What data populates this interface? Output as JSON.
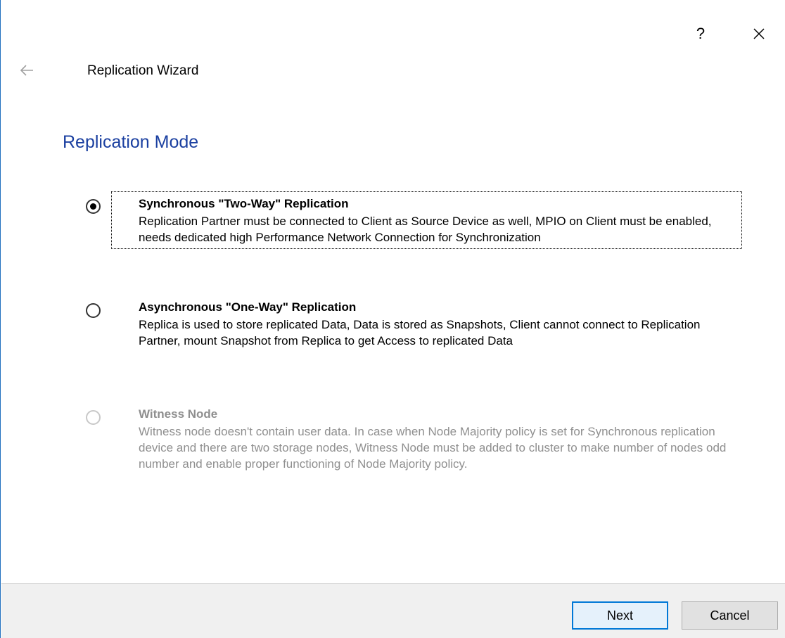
{
  "window": {
    "help_label": "?",
    "close_icon": "close-icon",
    "back_icon": "back-arrow-icon"
  },
  "header": {
    "wizard_title": "Replication Wizard",
    "section_title": "Replication Mode"
  },
  "options": [
    {
      "title": "Synchronous \"Two-Way\" Replication",
      "description": "Replication Partner must be connected to Client as Source Device as well, MPIO on Client must be enabled, needs dedicated high Performance Network Connection for Synchronization",
      "selected": true,
      "enabled": true
    },
    {
      "title": "Asynchronous \"One-Way\" Replication",
      "description": "Replica is used to store replicated Data, Data is stored as Snapshots, Client cannot connect to Replication Partner, mount Snapshot from Replica to get Access to replicated Data",
      "selected": false,
      "enabled": true
    },
    {
      "title": "Witness Node",
      "description": "Witness node doesn't contain user data. In case when Node Majority policy is set for Synchronous replication device and there are two storage nodes, Witness Node must be added to cluster to make number of nodes odd number and enable proper functioning of Node Majority policy.",
      "selected": false,
      "enabled": false
    }
  ],
  "footer": {
    "next_label": "Next",
    "cancel_label": "Cancel"
  },
  "colors": {
    "section_title": "#1a3fa0",
    "primary_button_border": "#0078d7",
    "disabled_text": "#8f8f8f"
  }
}
